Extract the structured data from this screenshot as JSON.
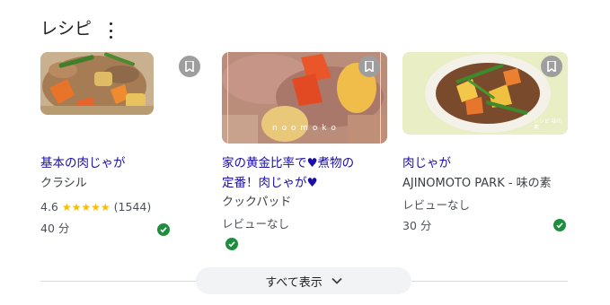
{
  "header": {
    "title": "レシピ"
  },
  "cards": [
    {
      "title": "基本の肉じゃが",
      "source": "クラシル",
      "rating": "4.6",
      "stars": "★★★★★",
      "reviews": "(1544)",
      "time": "40 分"
    },
    {
      "title": "家の黄金比率で♥煮物の定番！肉じゃが♥",
      "source": "クックパッド",
      "review_note": "レビューなし",
      "watermark": "n o o m o k o"
    },
    {
      "title": "肉じゃが",
      "source": "AJINOMOTO PARK - 味の素",
      "review_note": "レビューなし",
      "time": "30 分",
      "watermark": "レシピ 味の素"
    }
  ],
  "footer": {
    "show_all": "すべて表示"
  },
  "colors": {
    "link": "#1a0dab",
    "verified": "#1e8e3e",
    "star": "#fbbc04",
    "save_button": "#9e9e9e"
  }
}
